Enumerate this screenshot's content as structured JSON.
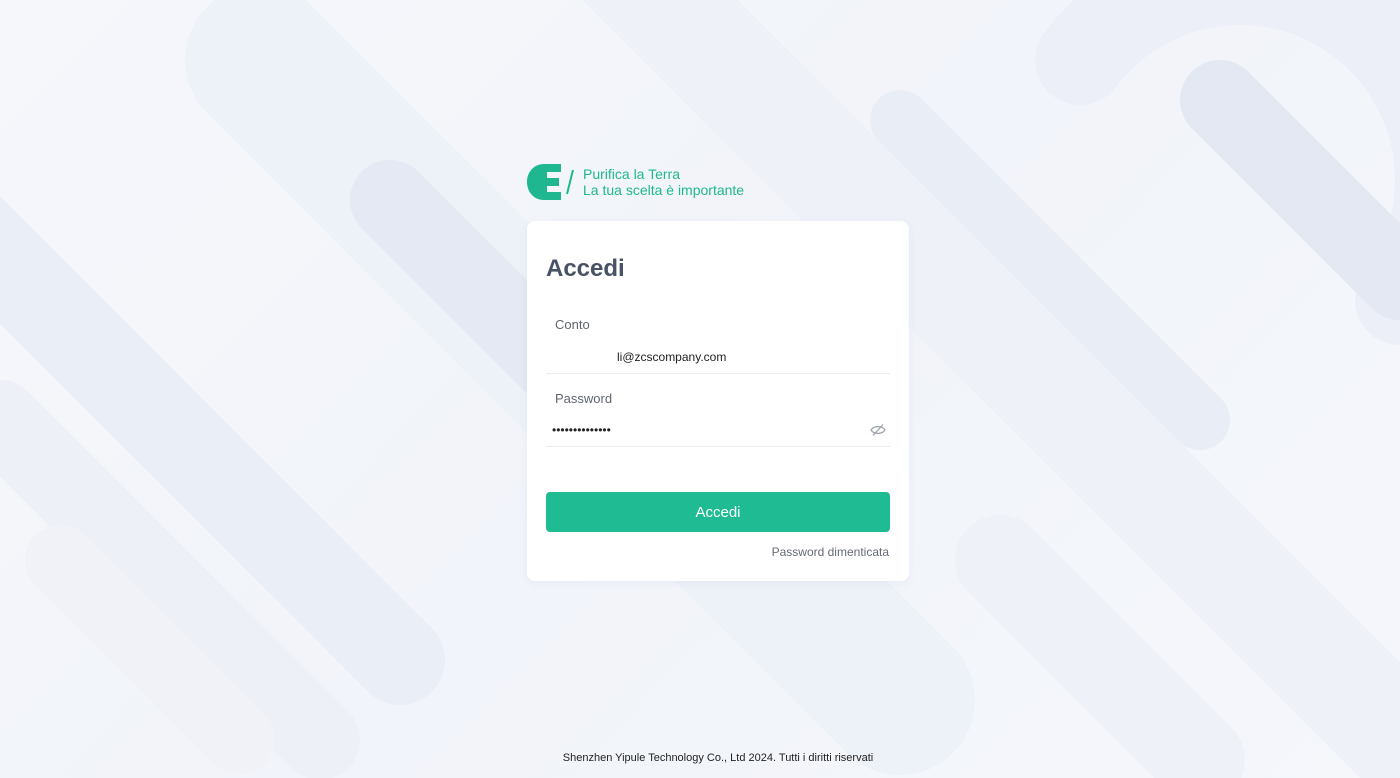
{
  "brand": {
    "line1": "Purifica la Terra",
    "line2": "La tua scelta è importante",
    "logo_icon": "leaf-e-logo-icon",
    "accent_color": "#1fb78f"
  },
  "login": {
    "title": "Accedi",
    "account_label": "Conto",
    "account_value": "li@zcscompany.com",
    "password_label": "Password",
    "password_value": "••••••••••••••",
    "visibility_icon": "eye-off-icon",
    "submit_label": "Accedi",
    "forgot_label": "Password dimenticata",
    "button_color": "#1fbb92"
  },
  "footer": {
    "text": "Shenzhen Yipule Technology Co., Ltd 2024. Tutti i diritti riservati"
  }
}
